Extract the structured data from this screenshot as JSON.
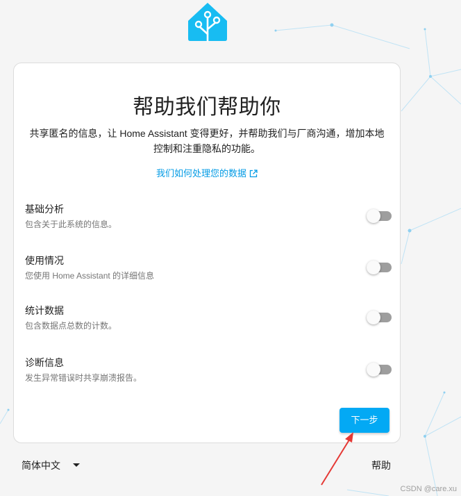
{
  "app": {
    "logo_icon": "home-assistant-logo-icon",
    "brand_color": "#03a9f4"
  },
  "card": {
    "title": "帮助我们帮助你",
    "description": "共享匿名的信息，让 Home Assistant 变得更好，并帮助我们与厂商沟通，增加本地控制和注重隐私的功能。",
    "data_link_label": "我们如何处理您的数据",
    "data_link_icon": "open-in-new-icon",
    "options": [
      {
        "title": "基础分析",
        "subtitle": "包含关于此系统的信息。",
        "enabled": false
      },
      {
        "title": "使用情况",
        "subtitle": "您使用 Home Assistant 的详细信息",
        "enabled": false
      },
      {
        "title": "统计数据",
        "subtitle": "包含数据点总数的计数。",
        "enabled": false
      },
      {
        "title": "诊断信息",
        "subtitle": "发生异常错误时共享崩溃报告。",
        "enabled": false
      }
    ],
    "next_button_label": "下一步"
  },
  "footer": {
    "language_label": "简体中文",
    "language_icon": "caret-down-icon",
    "help_label": "帮助"
  },
  "annotation": {
    "arrow_color": "#e53935"
  },
  "watermark": "CSDN @care.xu"
}
